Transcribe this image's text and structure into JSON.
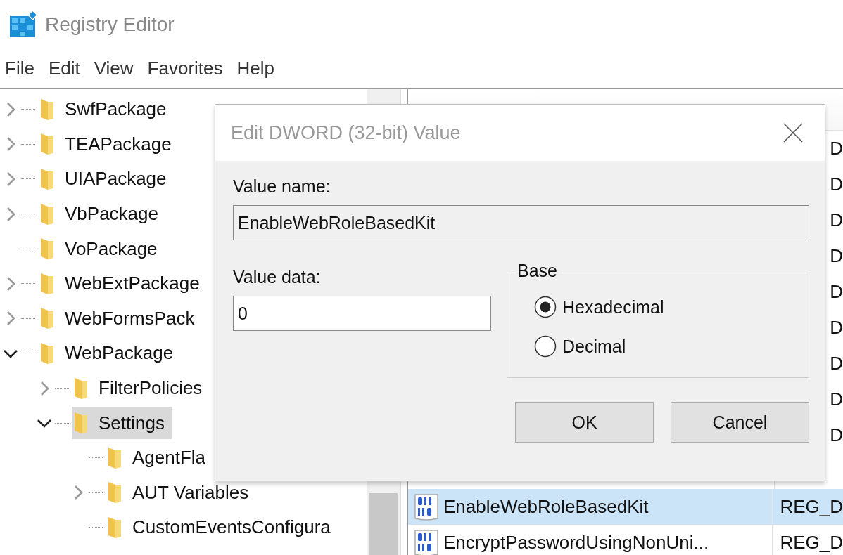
{
  "window": {
    "title": "Registry Editor"
  },
  "menu": [
    "File",
    "Edit",
    "View",
    "Favorites",
    "Help"
  ],
  "tree": [
    {
      "label": "SwfPackage",
      "kind": "branch",
      "expanded": false,
      "selected": false
    },
    {
      "label": "TEAPackage",
      "kind": "branch",
      "expanded": false,
      "selected": false
    },
    {
      "label": "UIAPackage",
      "kind": "branch",
      "expanded": false,
      "selected": false
    },
    {
      "label": "VbPackage",
      "kind": "branch",
      "expanded": false,
      "selected": false
    },
    {
      "label": "VoPackage",
      "kind": "leaf",
      "selected": false
    },
    {
      "label": "WebExtPackage",
      "kind": "branch",
      "expanded": false,
      "selected": false
    },
    {
      "label": "WebFormsPack",
      "kind": "branch",
      "expanded": false,
      "selected": false
    },
    {
      "label": "WebPackage",
      "kind": "branch",
      "expanded": true,
      "selected": false,
      "children": [
        {
          "label": "FilterPolicies",
          "kind": "branch",
          "expanded": false,
          "selected": false
        },
        {
          "label": "Settings",
          "kind": "branch",
          "expanded": true,
          "selected": true,
          "children": [
            {
              "label": "AgentFla",
              "kind": "leaf",
              "selected": false
            },
            {
              "label": "AUT Variables",
              "kind": "branch",
              "expanded": false,
              "selected": false
            },
            {
              "label": "CustomEventsConfigura",
              "kind": "leaf",
              "selected": false
            }
          ]
        }
      ]
    }
  ],
  "values": [
    {
      "kind": "fragment",
      "type": "D",
      "selected": false
    },
    {
      "kind": "fragment",
      "type": "D",
      "selected": false
    },
    {
      "kind": "fragment",
      "type": "D",
      "selected": false
    },
    {
      "kind": "fragment",
      "type": "D",
      "selected": false
    },
    {
      "kind": "fragment",
      "type": "D",
      "selected": false
    },
    {
      "kind": "fragment",
      "type": "D",
      "selected": false
    },
    {
      "kind": "fragment",
      "type": "D",
      "selected": false
    },
    {
      "kind": "fragment",
      "type": "D",
      "selected": false
    },
    {
      "kind": "fragment",
      "type": "D",
      "selected": false
    },
    {
      "kind": "hidden",
      "selected": false
    },
    {
      "kind": "entry",
      "name": "EnableWebRoleBasedKit",
      "type": "REG_D",
      "selected": true
    },
    {
      "kind": "entry",
      "name": "EncryptPasswordUsingNonUni...",
      "type": "REG_D",
      "selected": false
    }
  ],
  "dialog": {
    "title": "Edit DWORD (32-bit) Value",
    "value_name_label": "Value name:",
    "value_name": "EnableWebRoleBasedKit",
    "value_data_label": "Value data:",
    "value_data": "0",
    "base_label": "Base",
    "base_options": [
      {
        "label": "Hexadecimal",
        "selected": true
      },
      {
        "label": "Decimal",
        "selected": false
      }
    ],
    "buttons": [
      "OK",
      "Cancel"
    ]
  }
}
